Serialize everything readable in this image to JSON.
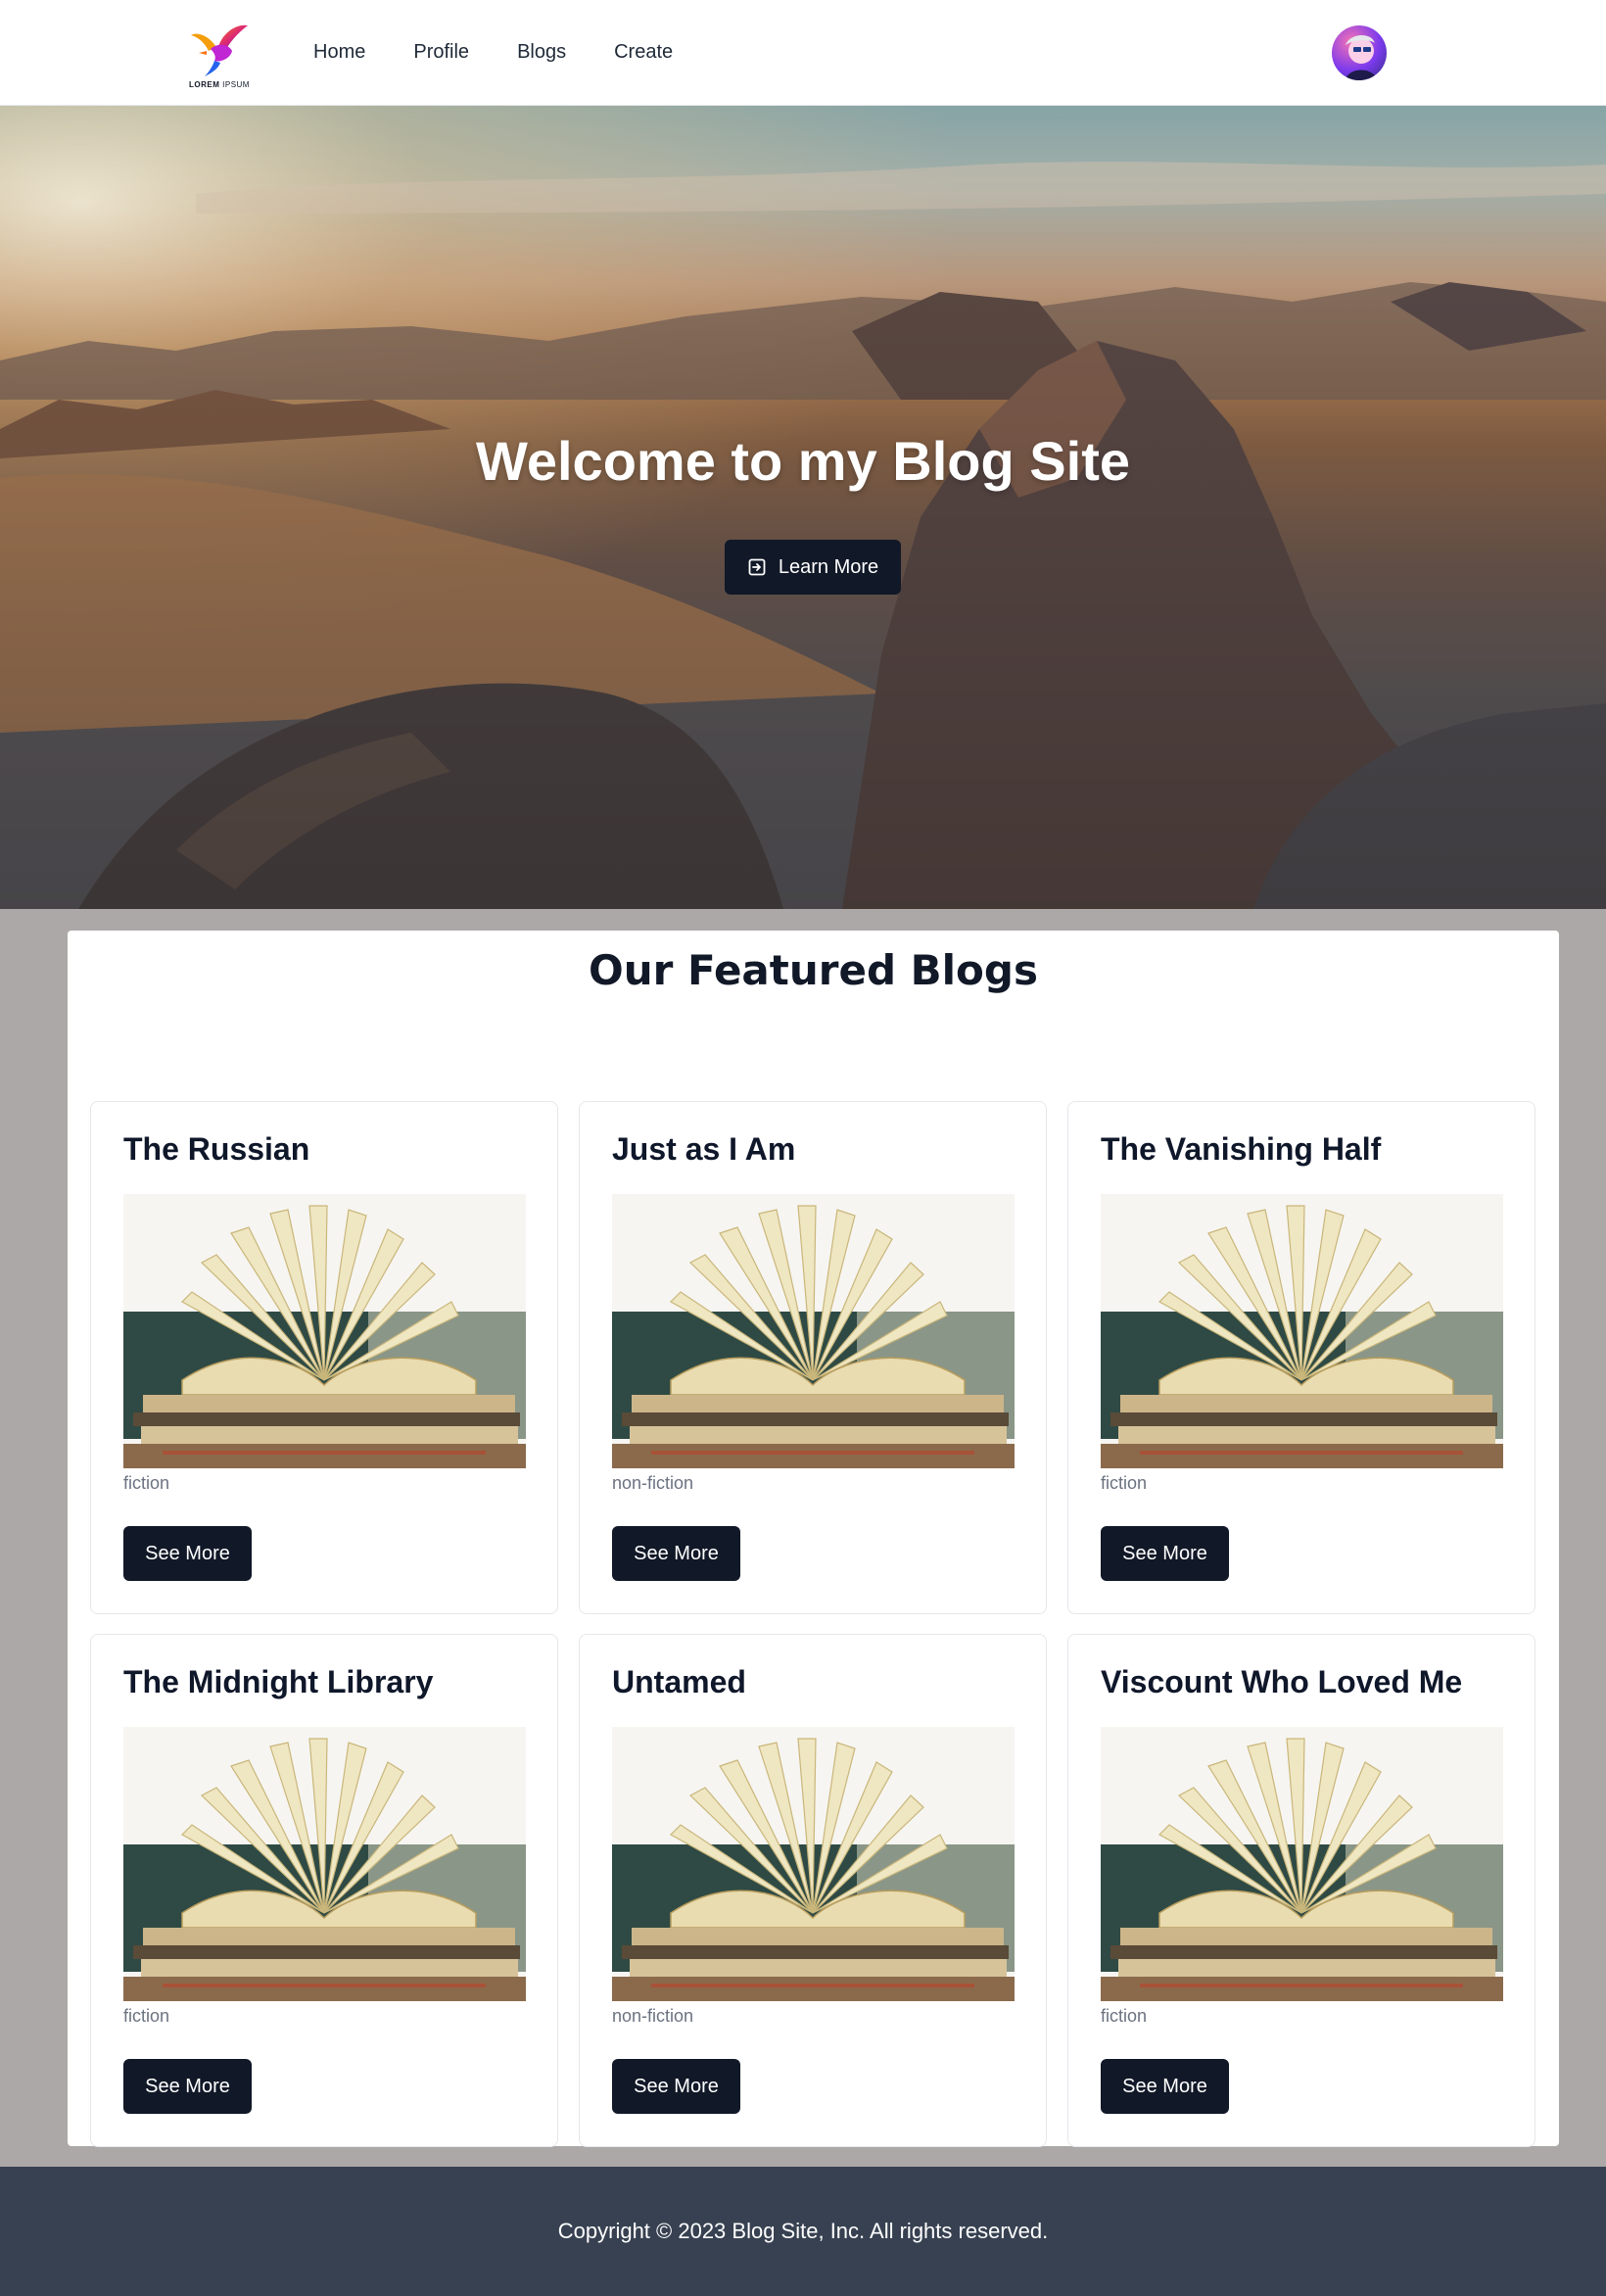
{
  "nav": {
    "logo_text_bold": "LOREM",
    "logo_text_light": " IPSUM",
    "links": [
      "Home",
      "Profile",
      "Blogs",
      "Create"
    ]
  },
  "hero": {
    "title": "Welcome to my Blog Site",
    "button_label": "Learn More",
    "button_icon": "sign-in-icon"
  },
  "featured": {
    "title": "Our Featured Blogs",
    "cards": [
      {
        "title": "The Russian",
        "category": "fiction",
        "button_label": "See More"
      },
      {
        "title": "Just as I Am",
        "category": "non-fiction",
        "button_label": "See More"
      },
      {
        "title": "The Vanishing Half",
        "category": "fiction",
        "button_label": "See More"
      },
      {
        "title": "The Midnight Library",
        "category": "fiction",
        "button_label": "See More"
      },
      {
        "title": "Untamed",
        "category": "non-fiction",
        "button_label": "See More"
      },
      {
        "title": "Viscount Who Loved Me",
        "category": "fiction",
        "button_label": "See More"
      }
    ]
  },
  "footer": {
    "text": "Copyright © 2023 Blog Site, Inc. All rights reserved."
  },
  "colors": {
    "primary_button": "#111827",
    "footer_bg": "#374151",
    "page_bg": "#aca8a8"
  }
}
